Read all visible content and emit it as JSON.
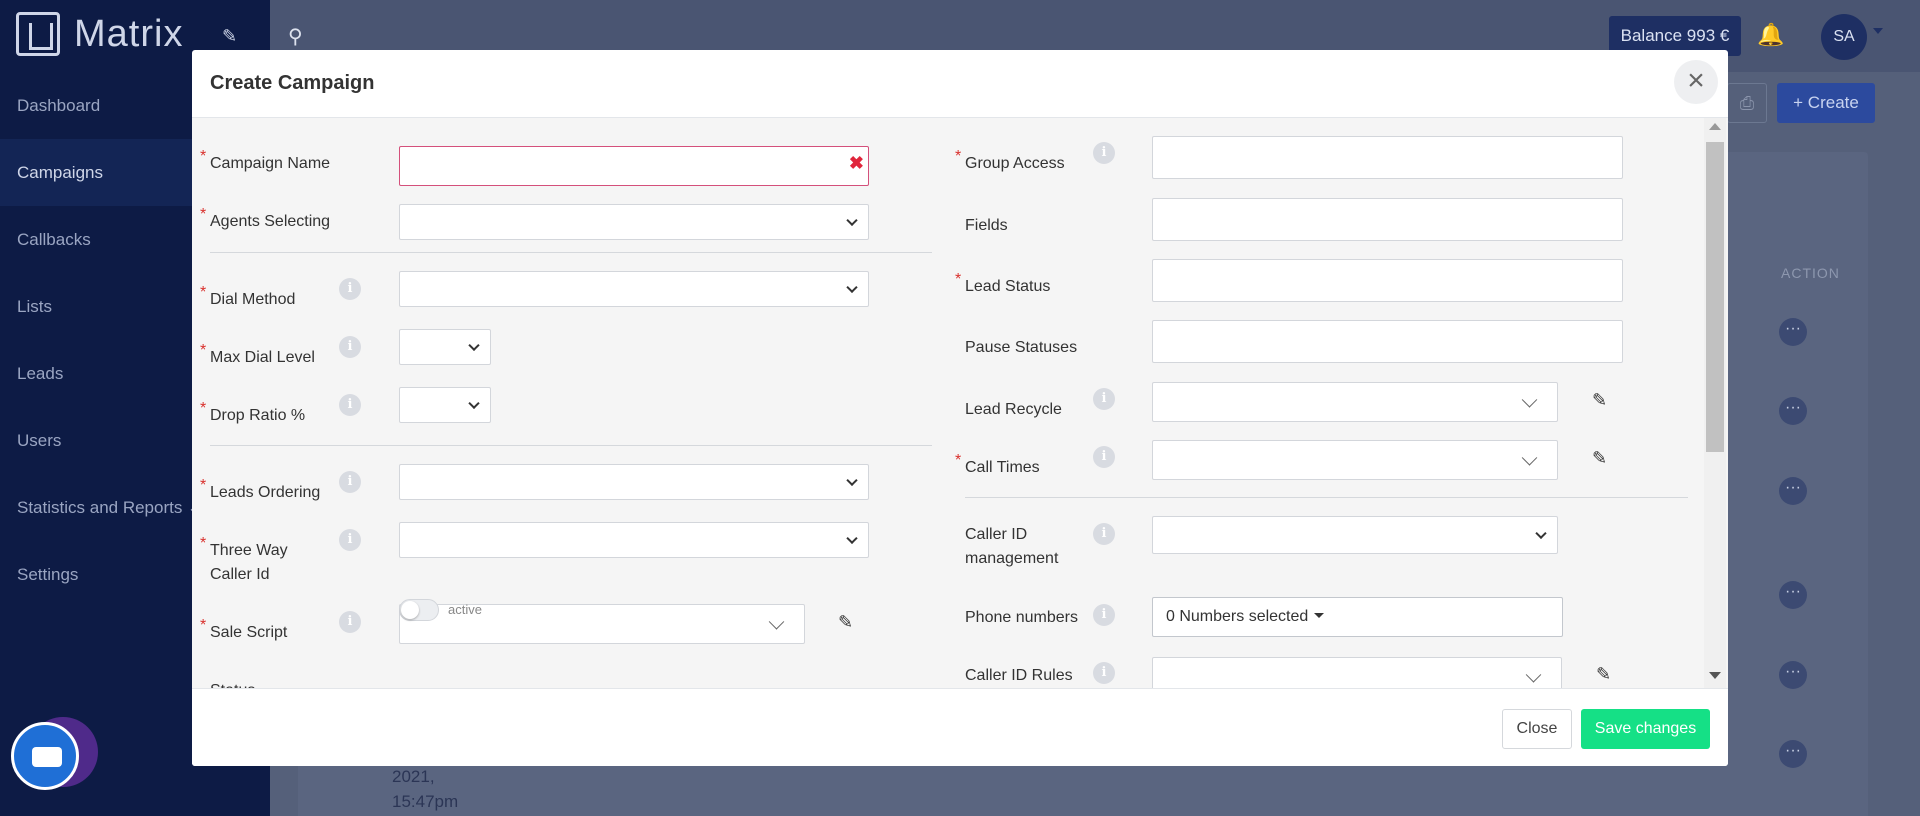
{
  "app": {
    "name": "Matrix"
  },
  "sidebar": {
    "items": [
      {
        "label": "Dashboard"
      },
      {
        "label": "Campaigns"
      },
      {
        "label": "Callbacks"
      },
      {
        "label": "Lists"
      },
      {
        "label": "Leads"
      },
      {
        "label": "Users"
      },
      {
        "label": "Statistics and Reports ⌄"
      },
      {
        "label": "Settings"
      }
    ]
  },
  "topbar": {
    "balance": "Balance 993 €",
    "avatar_initials": "SA"
  },
  "page": {
    "create_label": "+ Create",
    "action_header": "ACTION",
    "date_line1": "2021,",
    "date_line2": "15:47pm"
  },
  "modal": {
    "title": "Create Campaign",
    "close_icon": "×",
    "left": {
      "campaign_name": "Campaign Name",
      "agents_selecting": "Agents Selecting",
      "dial_method": "Dial Method",
      "max_dial_level": "Max Dial Level",
      "drop_ratio": "Drop Ratio %",
      "leads_ordering": "Leads Ordering",
      "three_way_caller_id": "Three Way Caller Id",
      "sale_script": "Sale Script",
      "status": "Status",
      "status_toggle_label": "active"
    },
    "right": {
      "group_access": "Group Access",
      "fields": "Fields",
      "lead_status": "Lead Status",
      "pause_statuses": "Pause Statuses",
      "lead_recycle": "Lead Recycle",
      "call_times": "Call Times",
      "caller_id_management": "Caller ID management",
      "phone_numbers": "Phone numbers",
      "phone_numbers_value": "0 Numbers selected",
      "caller_id_rules": "Caller ID Rules"
    },
    "footer": {
      "close_label": "Close",
      "save_label": "Save changes"
    }
  },
  "colors": {
    "primary": "#15e086",
    "required": "#d9312d",
    "sidebar": "#0d1b45"
  }
}
